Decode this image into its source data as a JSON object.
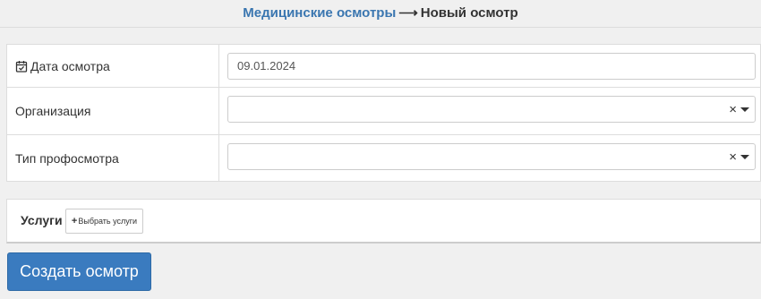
{
  "breadcrumb": {
    "parent": "Медицинские осмотры",
    "arrow": "⟶",
    "current": "Новый осмотр"
  },
  "form": {
    "date_label": "Дата осмотра",
    "date_value": "09.01.2024",
    "organization_label": "Организация",
    "organization_value": "",
    "exam_type_label": "Тип профосмотра",
    "exam_type_value": ""
  },
  "select_clear_glyph": "×",
  "services": {
    "title": "Услуги",
    "choose_button_plus": "+",
    "choose_button_label": "Выбрать услуги"
  },
  "submit": {
    "label": "Создать осмотр"
  },
  "colors": {
    "link": "#3a76b0",
    "primary_button": "#3a7bbf",
    "background": "#f0f0f0"
  },
  "icons": {
    "date": "calendar-check-icon",
    "clear": "clear-icon",
    "dropdown": "caret-down-icon",
    "add": "plus-icon"
  }
}
